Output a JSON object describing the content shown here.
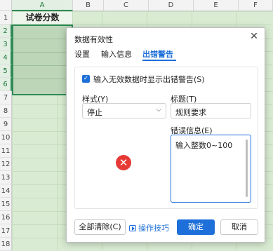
{
  "sheet": {
    "columns": [
      "A",
      "B",
      "C",
      "D",
      "E",
      "F"
    ],
    "rows": [
      "1",
      "2",
      "3",
      "4",
      "5",
      "6",
      "7",
      "8",
      "9",
      "10",
      "11",
      "12",
      "13",
      "14",
      "15",
      "16",
      "17",
      "18"
    ],
    "cell_a1": "试卷分数"
  },
  "dialog": {
    "title": "数据有效性",
    "tabs": [
      "设置",
      "输入信息",
      "出错警告"
    ],
    "active_tab": "出错警告",
    "checkbox_label": "输入无效数据时显示出错警告(S)",
    "style_label": "样式(Y)",
    "style_value": "停止",
    "title_label": "标题(T)",
    "title_value": "规则要求",
    "error_label": "错误信息(E)",
    "error_value": "输入整数0~100",
    "clear_all": "全部清除(C)",
    "tips": "操作技巧",
    "ok": "确定",
    "cancel": "取消"
  },
  "colors": {
    "accent": "#1e6fd9",
    "selection_border": "#2e8b57",
    "error": "#e53935"
  }
}
